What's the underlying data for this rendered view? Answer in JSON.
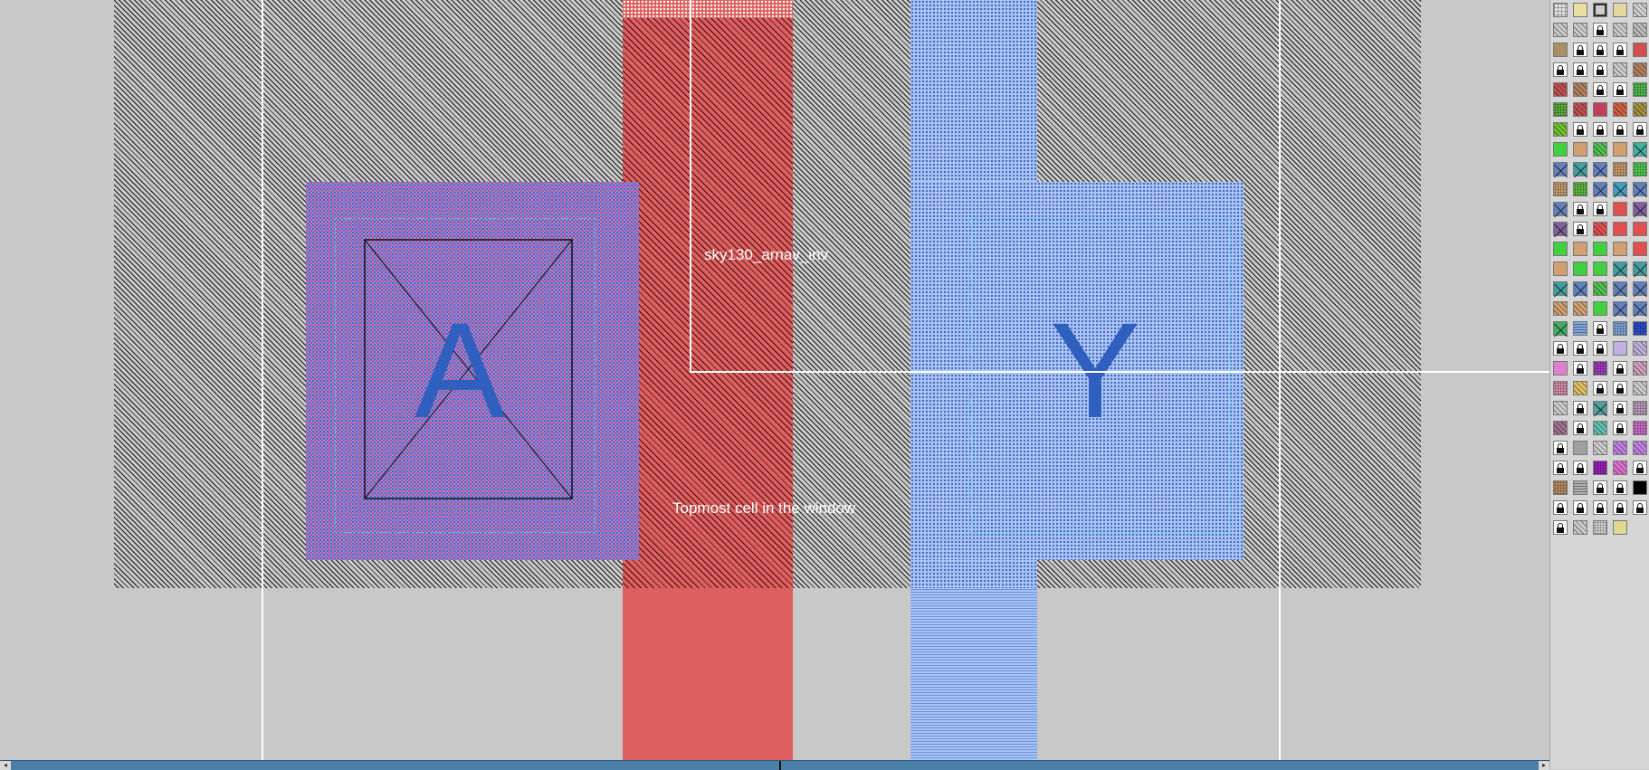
{
  "canvas": {
    "labels": {
      "cell_name": "sky130_arnav_inv",
      "topmost_note": "Topmost cell in the window"
    },
    "pins": {
      "input": "A",
      "output": "Y"
    }
  },
  "scrollbar": {
    "left_arrow": "◂",
    "right_arrow": "▸"
  },
  "palette": {
    "columns": 5,
    "swatches": [
      {
        "bg": "#e6e6e6",
        "pattern": "grid",
        "lock": false
      },
      {
        "bg": "#e8e0a0",
        "pattern": "solid",
        "lock": false
      },
      {
        "bg": "#cccccc",
        "pattern": "box",
        "lock": false
      },
      {
        "bg": "#e0d8a0",
        "pattern": "solid",
        "lock": false
      },
      {
        "bg": "#d0d0d0",
        "pattern": "diag",
        "lock": false
      },
      {
        "bg": "#cccccc",
        "pattern": "diag",
        "lock": false
      },
      {
        "bg": "#cccccc",
        "pattern": "diag",
        "lock": false
      },
      {
        "bg": "#cccccc",
        "pattern": "solid",
        "lock": true
      },
      {
        "bg": "#cccccc",
        "pattern": "diag",
        "lock": false
      },
      {
        "bg": "#bbbbbb",
        "pattern": "diag",
        "lock": false
      },
      {
        "bg": "#a89060",
        "pattern": "solid",
        "lock": false
      },
      {
        "bg": "#cccccc",
        "pattern": "solid",
        "lock": true
      },
      {
        "bg": "#cccccc",
        "pattern": "solid",
        "lock": true
      },
      {
        "bg": "#cccccc",
        "pattern": "solid",
        "lock": true
      },
      {
        "bg": "#d05050",
        "pattern": "solid",
        "lock": false
      },
      {
        "bg": "#cccccc",
        "pattern": "solid",
        "lock": true
      },
      {
        "bg": "#cccccc",
        "pattern": "solid",
        "lock": true
      },
      {
        "bg": "#cccccc",
        "pattern": "solid",
        "lock": true
      },
      {
        "bg": "#cccccc",
        "pattern": "diag",
        "lock": false
      },
      {
        "bg": "#b08060",
        "pattern": "diag",
        "lock": false
      },
      {
        "bg": "#c05050",
        "pattern": "diag",
        "lock": false
      },
      {
        "bg": "#b08060",
        "pattern": "diag",
        "lock": false
      },
      {
        "bg": "#cccccc",
        "pattern": "solid",
        "lock": true
      },
      {
        "bg": "#cccccc",
        "pattern": "solid",
        "lock": true
      },
      {
        "bg": "#50c050",
        "pattern": "dots",
        "lock": false
      },
      {
        "bg": "#60b040",
        "pattern": "dots",
        "lock": false
      },
      {
        "bg": "#c05050",
        "pattern": "diag",
        "lock": false
      },
      {
        "bg": "#c04060",
        "pattern": "solid",
        "lock": false
      },
      {
        "bg": "#d06040",
        "pattern": "diag",
        "lock": false
      },
      {
        "bg": "#a09040",
        "pattern": "diag",
        "lock": false
      },
      {
        "bg": "#70c030",
        "pattern": "diag",
        "lock": false
      },
      {
        "bg": "#cccccc",
        "pattern": "solid",
        "lock": true
      },
      {
        "bg": "#cccccc",
        "pattern": "solid",
        "lock": true
      },
      {
        "bg": "#cccccc",
        "pattern": "solid",
        "lock": true
      },
      {
        "bg": "#cccccc",
        "pattern": "solid",
        "lock": true
      },
      {
        "bg": "#40d040",
        "pattern": "solid",
        "lock": false
      },
      {
        "bg": "#d0a070",
        "pattern": "solid",
        "lock": false
      },
      {
        "bg": "#50c050",
        "pattern": "diag",
        "lock": false
      },
      {
        "bg": "#d0a070",
        "pattern": "solid",
        "lock": false
      },
      {
        "bg": "#40b0a0",
        "pattern": "x",
        "lock": false
      },
      {
        "bg": "#6080c0",
        "pattern": "x",
        "lock": false
      },
      {
        "bg": "#40a0a0",
        "pattern": "x",
        "lock": false
      },
      {
        "bg": "#6080c0",
        "pattern": "x",
        "lock": false
      },
      {
        "bg": "#d0a070",
        "pattern": "dots",
        "lock": false
      },
      {
        "bg": "#50d050",
        "pattern": "dots",
        "lock": false
      },
      {
        "bg": "#d0a070",
        "pattern": "dots",
        "lock": false
      },
      {
        "bg": "#60c040",
        "pattern": "dots",
        "lock": false
      },
      {
        "bg": "#6080c0",
        "pattern": "x",
        "lock": false
      },
      {
        "bg": "#40a0c0",
        "pattern": "x",
        "lock": false
      },
      {
        "bg": "#6080c0",
        "pattern": "x",
        "lock": false
      },
      {
        "bg": "#6080c0",
        "pattern": "x",
        "lock": false
      },
      {
        "bg": "#cccccc",
        "pattern": "solid",
        "lock": true
      },
      {
        "bg": "#cccccc",
        "pattern": "solid",
        "lock": true
      },
      {
        "bg": "#e05050",
        "pattern": "solid",
        "lock": false
      },
      {
        "bg": "#8060a0",
        "pattern": "x",
        "lock": false
      },
      {
        "bg": "#8060a0",
        "pattern": "x",
        "lock": false
      },
      {
        "bg": "#cccccc",
        "pattern": "solid",
        "lock": true
      },
      {
        "bg": "#e05050",
        "pattern": "diag",
        "lock": false
      },
      {
        "bg": "#e05050",
        "pattern": "solid",
        "lock": false
      },
      {
        "bg": "#e05050",
        "pattern": "solid",
        "lock": false
      },
      {
        "bg": "#40d040",
        "pattern": "solid",
        "lock": false
      },
      {
        "bg": "#d0a070",
        "pattern": "solid",
        "lock": false
      },
      {
        "bg": "#40d040",
        "pattern": "solid",
        "lock": false
      },
      {
        "bg": "#d0a070",
        "pattern": "solid",
        "lock": false
      },
      {
        "bg": "#e05050",
        "pattern": "solid",
        "lock": false
      },
      {
        "bg": "#d0a070",
        "pattern": "solid",
        "lock": false
      },
      {
        "bg": "#40d040",
        "pattern": "solid",
        "lock": false
      },
      {
        "bg": "#40d040",
        "pattern": "solid",
        "lock": false
      },
      {
        "bg": "#40a0a0",
        "pattern": "x",
        "lock": false
      },
      {
        "bg": "#40a0a0",
        "pattern": "x",
        "lock": false
      },
      {
        "bg": "#40a0a0",
        "pattern": "x",
        "lock": false
      },
      {
        "bg": "#6080c0",
        "pattern": "x",
        "lock": false
      },
      {
        "bg": "#50c050",
        "pattern": "diag",
        "lock": false
      },
      {
        "bg": "#6080c0",
        "pattern": "x",
        "lock": false
      },
      {
        "bg": "#6080c0",
        "pattern": "x",
        "lock": false
      },
      {
        "bg": "#d0a070",
        "pattern": "diag",
        "lock": false
      },
      {
        "bg": "#d0a070",
        "pattern": "diag",
        "lock": false
      },
      {
        "bg": "#40d040",
        "pattern": "solid",
        "lock": false
      },
      {
        "bg": "#6080c0",
        "pattern": "x",
        "lock": false
      },
      {
        "bg": "#6080c0",
        "pattern": "x",
        "lock": false
      },
      {
        "bg": "#40b060",
        "pattern": "x",
        "lock": false
      },
      {
        "bg": "#80a8e0",
        "pattern": "lines",
        "lock": false
      },
      {
        "bg": "#cccccc",
        "pattern": "solid",
        "lock": true
      },
      {
        "bg": "#80a8e0",
        "pattern": "dots",
        "lock": false
      },
      {
        "bg": "#3050d0",
        "pattern": "dots",
        "lock": false
      },
      {
        "bg": "#cccccc",
        "pattern": "solid",
        "lock": true
      },
      {
        "bg": "#4040c0",
        "pattern": "solid",
        "lock": true
      },
      {
        "bg": "#cccccc",
        "pattern": "solid",
        "lock": true
      },
      {
        "bg": "#c0b0e0",
        "pattern": "solid",
        "lock": false
      },
      {
        "bg": "#c0b0e0",
        "pattern": "diag",
        "lock": false
      },
      {
        "bg": "#e080d0",
        "pattern": "solid",
        "lock": false
      },
      {
        "bg": "#cccccc",
        "pattern": "solid",
        "lock": true
      },
      {
        "bg": "#a040c0",
        "pattern": "dots",
        "lock": false
      },
      {
        "bg": "#cccccc",
        "pattern": "solid",
        "lock": true
      },
      {
        "bg": "#d0a0c0",
        "pattern": "diag",
        "lock": false
      },
      {
        "bg": "#e090b0",
        "pattern": "dots",
        "lock": false
      },
      {
        "bg": "#e0c060",
        "pattern": "diag",
        "lock": false
      },
      {
        "bg": "#cccccc",
        "pattern": "solid",
        "lock": true
      },
      {
        "bg": "#cccccc",
        "pattern": "solid",
        "lock": true
      },
      {
        "bg": "#cccccc",
        "pattern": "diag",
        "lock": false
      },
      {
        "bg": "#cccccc",
        "pattern": "diag",
        "lock": false
      },
      {
        "bg": "#cccccc",
        "pattern": "solid",
        "lock": true
      },
      {
        "bg": "#50a0a0",
        "pattern": "x",
        "lock": false
      },
      {
        "bg": "#cccccc",
        "pattern": "solid",
        "lock": true
      },
      {
        "bg": "#c0a0c0",
        "pattern": "dots",
        "lock": false
      },
      {
        "bg": "#a07090",
        "pattern": "diag",
        "lock": false
      },
      {
        "bg": "#cccccc",
        "pattern": "solid",
        "lock": true
      },
      {
        "bg": "#60c0b0",
        "pattern": "diag",
        "lock": false
      },
      {
        "bg": "#cccccc",
        "pattern": "solid",
        "lock": true
      },
      {
        "bg": "#d070d0",
        "pattern": "dots",
        "lock": false
      },
      {
        "bg": "#cccccc",
        "pattern": "solid",
        "lock": true
      },
      {
        "bg": "#a0a0a0",
        "pattern": "solid",
        "lock": false
      },
      {
        "bg": "#cccccc",
        "pattern": "diag",
        "lock": false
      },
      {
        "bg": "#c080e0",
        "pattern": "diag",
        "lock": false
      },
      {
        "bg": "#c080e0",
        "pattern": "diag",
        "lock": false
      },
      {
        "bg": "#cccccc",
        "pattern": "solid",
        "lock": true
      },
      {
        "bg": "#cccccc",
        "pattern": "solid",
        "lock": true
      },
      {
        "bg": "#a020c0",
        "pattern": "dots",
        "lock": false
      },
      {
        "bg": "#e070d0",
        "pattern": "diag",
        "lock": false
      },
      {
        "bg": "#cccccc",
        "pattern": "solid",
        "lock": true
      },
      {
        "bg": "#c09060",
        "pattern": "dots",
        "lock": false
      },
      {
        "bg": "#b0b0b0",
        "pattern": "lines",
        "lock": false
      },
      {
        "bg": "#cccccc",
        "pattern": "solid",
        "lock": true
      },
      {
        "bg": "#cccccc",
        "pattern": "solid",
        "lock": true
      },
      {
        "bg": "#000000",
        "pattern": "solid",
        "lock": false
      },
      {
        "bg": "#cccccc",
        "pattern": "solid",
        "lock": true
      },
      {
        "bg": "#cccccc",
        "pattern": "solid",
        "lock": true
      },
      {
        "bg": "#cccccc",
        "pattern": "solid",
        "lock": true
      },
      {
        "bg": "#cccccc",
        "pattern": "solid",
        "lock": true
      },
      {
        "bg": "#cccccc",
        "pattern": "solid",
        "lock": true
      },
      {
        "bg": "#cccccc",
        "pattern": "solid",
        "lock": true
      },
      {
        "bg": "#cccccc",
        "pattern": "diag",
        "lock": false
      },
      {
        "bg": "#d8d8d8",
        "pattern": "dots",
        "lock": false
      },
      {
        "bg": "#e0d890",
        "pattern": "solid",
        "lock": false
      }
    ]
  }
}
